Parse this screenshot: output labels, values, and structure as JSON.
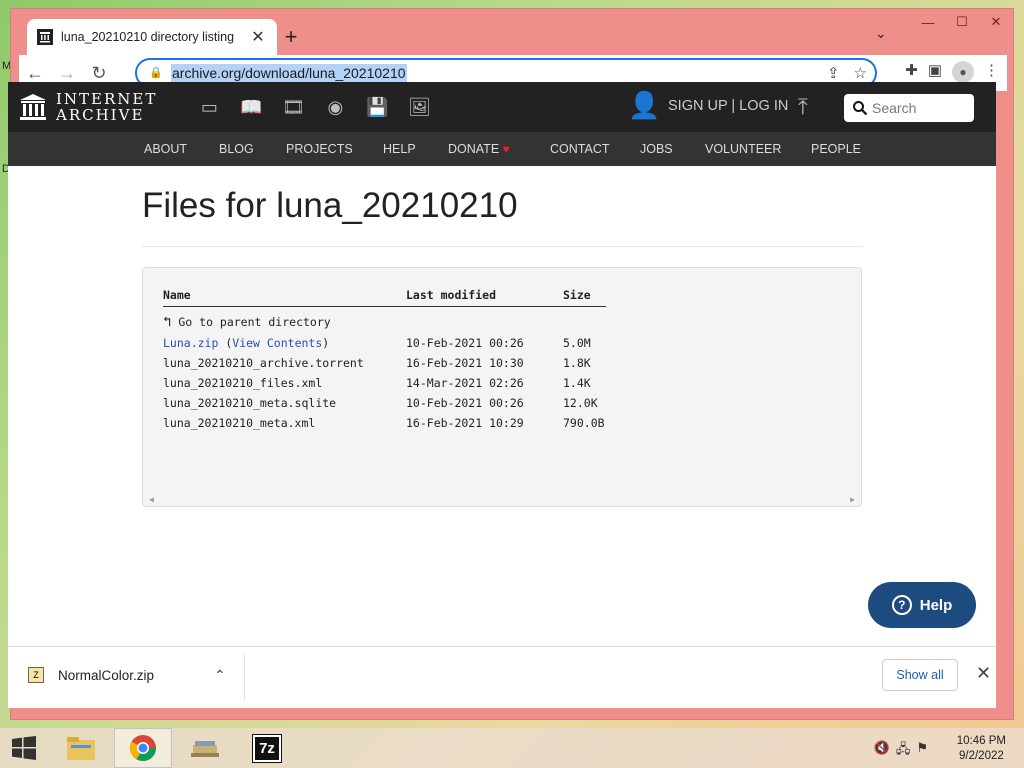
{
  "desktop": {
    "left_letters": [
      "M",
      "D"
    ]
  },
  "browser": {
    "tab_title": "luna_20210210 directory listing",
    "tab_close": "✕",
    "new_tab": "+",
    "tab_search": "⌄",
    "win_min": "—",
    "win_max": "☐",
    "win_close": "✕",
    "url": "archive.org/download/luna_20210210"
  },
  "ia": {
    "logo_line1": "INTERNET",
    "logo_line2": "ARCHIVE",
    "signup": "SIGN UP | LOG IN",
    "search_placeholder": "Search",
    "nav": [
      "ABOUT",
      "BLOG",
      "PROJECTS",
      "HELP",
      "DONATE",
      "CONTACT",
      "JOBS",
      "VOLUNTEER",
      "PEOPLE"
    ]
  },
  "listing": {
    "title": "Files for luna_20210210",
    "headers": {
      "name": "Name",
      "modified": "Last modified",
      "size": "Size"
    },
    "parent": "Go to parent directory",
    "rows": [
      {
        "name": "Luna.zip",
        "extra_open": "(",
        "extra_link": "View Contents",
        "extra_close": ")",
        "modified": "10-Feb-2021 00:26",
        "size": "5.0M"
      },
      {
        "name": "luna_20210210_archive.torrent",
        "modified": "16-Feb-2021 10:30",
        "size": "1.8K"
      },
      {
        "name": "luna_20210210_files.xml",
        "modified": "14-Mar-2021 02:26",
        "size": "1.4K"
      },
      {
        "name": "luna_20210210_meta.sqlite",
        "modified": "10-Feb-2021 00:26",
        "size": "12.0K"
      },
      {
        "name": "luna_20210210_meta.xml",
        "modified": "16-Feb-2021 10:29",
        "size": "790.0B"
      }
    ]
  },
  "help_button": "Help",
  "downloads": {
    "file": "NormalColor.zip",
    "show_all": "Show all",
    "close": "✕"
  },
  "taskbar": {
    "time": "10:46 PM",
    "date": "9/2/2022",
    "sevenzip": "7z"
  }
}
